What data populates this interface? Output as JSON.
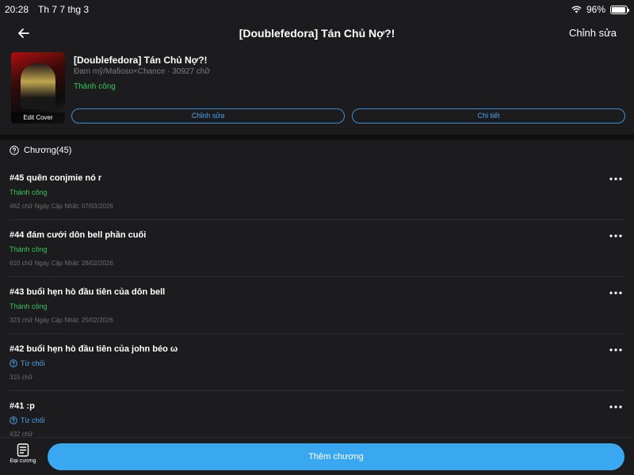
{
  "status_bar": {
    "time": "20:28",
    "date": "Th 7 7 thg 3",
    "battery": "96%",
    "battery_level": 0.96
  },
  "nav": {
    "title": "[Doublefedora] Tán Chủ Nợ?!",
    "edit_label": "Chỉnh sửa",
    "back_icon": "arrow-left-icon"
  },
  "book": {
    "title": "[Doublefedora] Tán Chủ Nợ?!",
    "meta": "Đam mỹ/Mafioso×Chance · 30927 chữ",
    "status": "Thành công",
    "cover_label": "Edit Cover",
    "edit_button": "Chỉnh sửa",
    "details_button": "Chi tiết"
  },
  "chapters": {
    "header": "Chương(45)",
    "items": [
      {
        "title": "#45 quên conjmie nó r",
        "status": "Thành công",
        "status_type": "ok",
        "meta": "462 chữ Ngày Cập Nhật: 07/03/2026"
      },
      {
        "title": "#44 đám cưới dôn bell phần cuối",
        "status": "Thành công",
        "status_type": "ok",
        "meta": "610 chữ Ngày Cập Nhật: 28/02/2026"
      },
      {
        "title": "#43 buổi hẹn hò đầu tiên của dôn bell",
        "status": "Thành công",
        "status_type": "ok",
        "meta": "323 chữ Ngày Cập Nhật: 25/02/2026"
      },
      {
        "title": "#42 buổi hẹn hò đầu tiên của john béo ω",
        "status": "Từ chối",
        "status_type": "rejected",
        "meta": "315 chữ"
      },
      {
        "title": "#41 :p",
        "status": "Từ chối",
        "status_type": "rejected",
        "meta": "432 chữ"
      }
    ]
  },
  "bottom": {
    "outline_label": "Đại cương",
    "add_chapter": "Thêm chương"
  },
  "colors": {
    "background": "#1c1c1e",
    "accent": "#3aa8f0",
    "success": "#34c759",
    "muted": "#6e6e73"
  }
}
